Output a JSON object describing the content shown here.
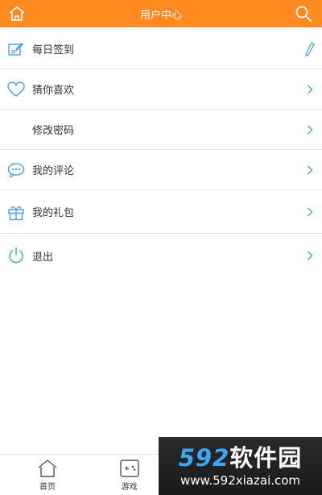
{
  "header": {
    "title": "用户中心",
    "left_icon": "home-icon",
    "right_icon": "search-icon",
    "color": "#ff8a1f"
  },
  "menu": {
    "items": [
      {
        "label": "每日签到",
        "icon": "sign-in-icon",
        "right": "pencil-icon"
      },
      {
        "label": "猜你喜欢",
        "icon": "heart-icon",
        "right": "chevron-right-icon"
      },
      {
        "label": "修改密码",
        "icon": "",
        "right": "chevron-right-icon"
      },
      {
        "label": "我的评论",
        "icon": "comment-icon",
        "right": "chevron-right-icon"
      },
      {
        "label": "我的礼包",
        "icon": "gift-icon",
        "right": "chevron-right-icon"
      },
      {
        "label": "退出",
        "icon": "power-icon",
        "right": "chevron-right-icon"
      }
    ]
  },
  "tabs": [
    {
      "label": "首页",
      "icon": "home-icon"
    },
    {
      "label": "游戏",
      "icon": "gamepad-icon"
    }
  ],
  "watermark": {
    "brand_num": "592",
    "brand_text": "软件园",
    "url": "www.592xiazai.com"
  }
}
